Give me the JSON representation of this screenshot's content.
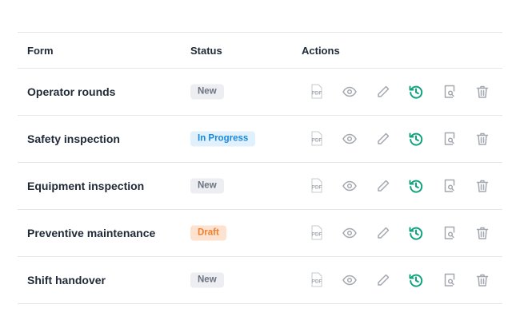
{
  "table": {
    "headers": {
      "form": "Form",
      "status": "Status",
      "actions": "Actions"
    },
    "rows": [
      {
        "form": "Operator rounds",
        "status": "New"
      },
      {
        "form": "Safety inspection",
        "status": "In Progress"
      },
      {
        "form": "Equipment inspection",
        "status": "New"
      },
      {
        "form": "Preventive maintenance",
        "status": "Draft"
      },
      {
        "form": "Shift handover",
        "status": "New"
      }
    ],
    "pdf_icon_text": "PDF",
    "action_icons": [
      "pdf-icon",
      "eye-icon",
      "pencil-icon",
      "history-icon",
      "document-search-icon",
      "trash-icon"
    ]
  },
  "colors": {
    "icon_gray": "#a3a8b0",
    "history_green": "#10a37f",
    "status_new": "#6b7280",
    "status_in_progress": "#1a88db",
    "status_draft": "#f0802f"
  }
}
